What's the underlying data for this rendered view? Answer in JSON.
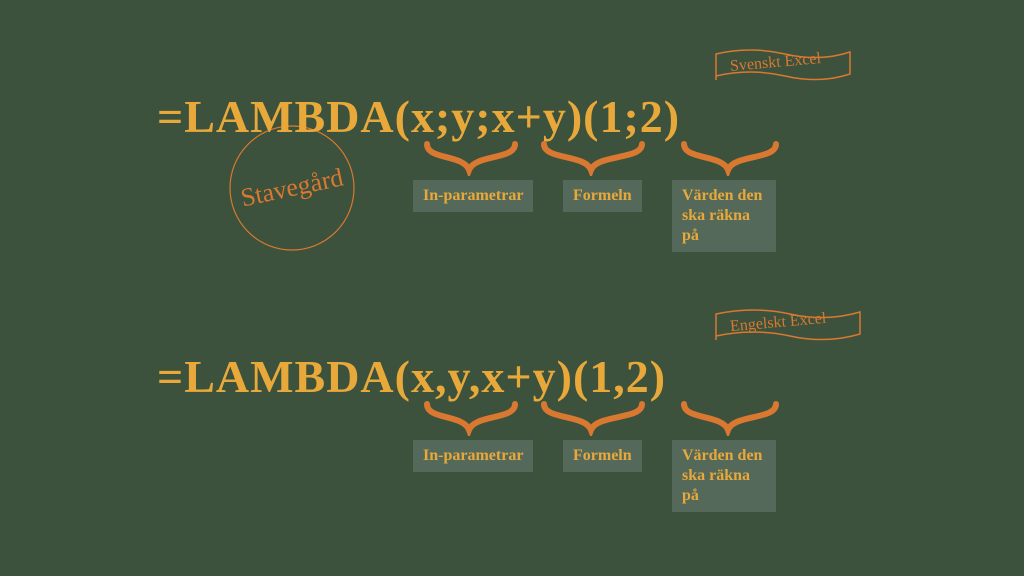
{
  "stamp": {
    "text": "Stavegård"
  },
  "swedish": {
    "flag": "Svenskt Excel",
    "formula": "=LAMBDA(x;y;x+y)(1;2)",
    "labels": {
      "inparams": "In-parametrar",
      "formula": "Formeln",
      "values": "Värden den ska räkna på"
    }
  },
  "english": {
    "flag": "Engelskt Excel",
    "formula": "=LAMBDA(x,y,x+y)(1,2)",
    "labels": {
      "inparams": "In-parametrar",
      "formula": "Formeln",
      "values": "Värden den ska räkna på"
    }
  },
  "colors": {
    "bg": "#3c523d",
    "text": "#e8a93a",
    "accent": "#d97830",
    "boxbg": "#54695a"
  }
}
